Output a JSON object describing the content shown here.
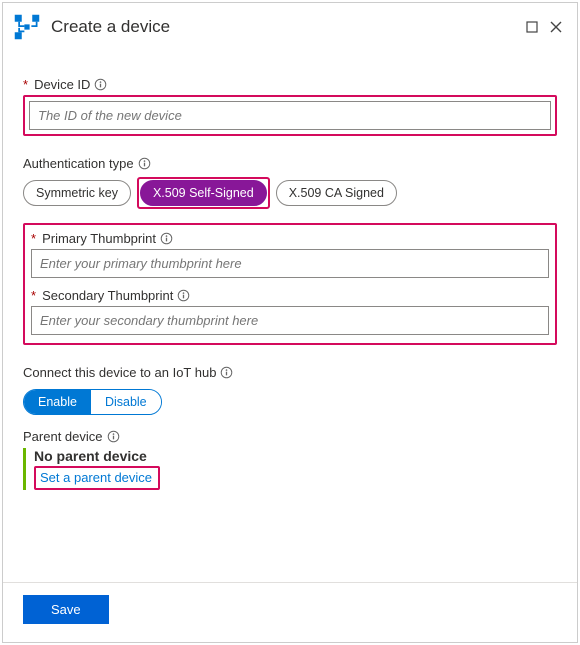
{
  "header": {
    "title": "Create a device"
  },
  "device_id": {
    "label": "Device ID",
    "placeholder": "The ID of the new device"
  },
  "auth": {
    "label": "Authentication type",
    "options": {
      "symmetric": "Symmetric key",
      "x509_self": "X.509 Self-Signed",
      "x509_ca": "X.509 CA Signed"
    }
  },
  "thumbprints": {
    "primary_label": "Primary Thumbprint",
    "primary_placeholder": "Enter your primary thumbprint here",
    "secondary_label": "Secondary Thumbprint",
    "secondary_placeholder": "Enter your secondary thumbprint here"
  },
  "connect": {
    "label": "Connect this device to an IoT hub",
    "enable": "Enable",
    "disable": "Disable"
  },
  "parent": {
    "label": "Parent device",
    "value": "No parent device",
    "link": "Set a parent device"
  },
  "footer": {
    "save": "Save"
  }
}
